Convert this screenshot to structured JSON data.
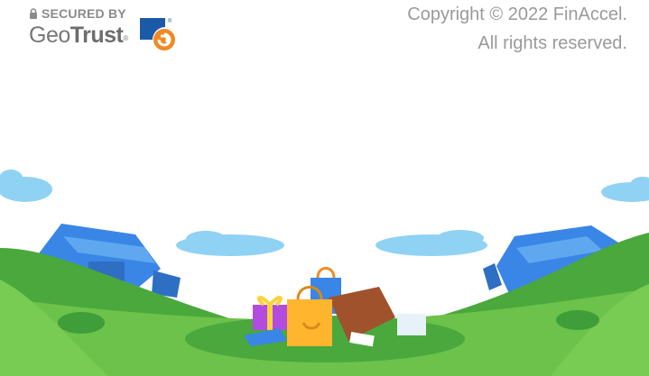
{
  "security_badge": {
    "secured_by": "SECURED BY",
    "brand_light": "Geo",
    "brand_bold": "Trust",
    "trademark": "®"
  },
  "footer": {
    "copyright_line": "Copyright © 2022 FinAccel.",
    "rights_line": "All rights reserved."
  },
  "colors": {
    "sky_cloud": "#8fd2f4",
    "hill_dark": "#3f9e3a",
    "hill_light": "#6cc24a",
    "shop_blue": "#3a86e6",
    "geotrust_orange": "#f08a24",
    "geotrust_blue": "#1b5aa6"
  },
  "icons": [
    "lock-icon",
    "geotrust-logo-icon",
    "shopping-illustration"
  ]
}
